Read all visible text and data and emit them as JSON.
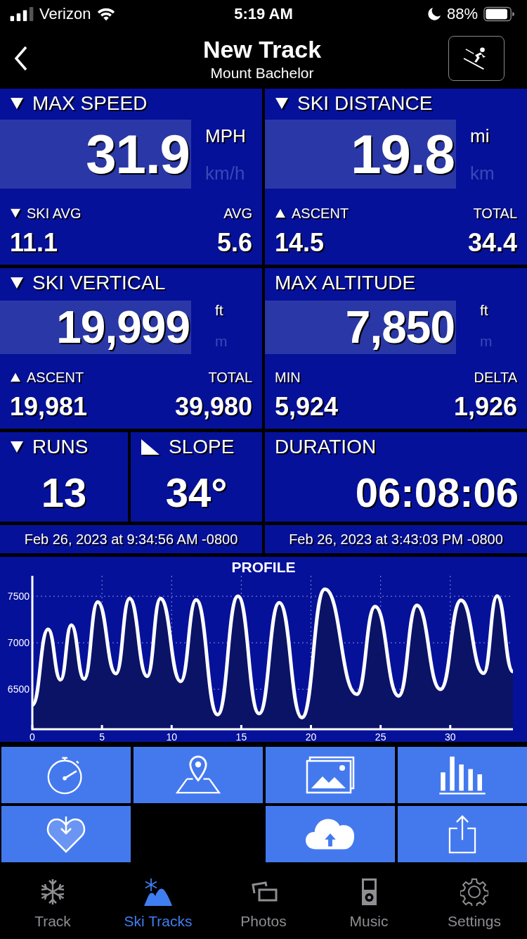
{
  "status_bar": {
    "carrier": "Verizon",
    "time": "5:19 AM",
    "battery": "88%"
  },
  "nav": {
    "title": "New Track",
    "subtitle": "Mount Bachelor"
  },
  "big_tiles": [
    {
      "icon": {
        "kind": "down"
      },
      "title": "MAX SPEED",
      "value": "31.9",
      "units": [
        {
          "label": "MPH",
          "selected": true
        },
        {
          "label": "km/h",
          "selected": false
        }
      ],
      "sub_left": {
        "icon": {
          "kind": "down"
        },
        "label": "SKI AVG",
        "value": "11.1"
      },
      "sub_right": {
        "label": "AVG",
        "value": "5.6"
      }
    },
    {
      "icon": {
        "kind": "down"
      },
      "title": "SKI DISTANCE",
      "value": "19.8",
      "units": [
        {
          "label": "mi",
          "selected": true
        },
        {
          "label": "km",
          "selected": false
        }
      ],
      "sub_left": {
        "icon": {
          "kind": "up"
        },
        "label": "ASCENT",
        "value": "14.5"
      },
      "sub_right": {
        "label": "TOTAL",
        "value": "34.4"
      }
    },
    {
      "icon": {
        "kind": "down"
      },
      "title": "SKI VERTICAL",
      "value": "19,999",
      "units": [
        {
          "label": "ft",
          "selected": true
        },
        {
          "label": "m",
          "selected": false
        }
      ],
      "sub_left": {
        "icon": {
          "kind": "up"
        },
        "label": "ASCENT",
        "value": "19,981"
      },
      "sub_right": {
        "label": "TOTAL",
        "value": "39,980"
      }
    },
    {
      "title": "MAX ALTITUDE",
      "value": "7,850",
      "units": [
        {
          "label": "ft",
          "selected": true
        },
        {
          "label": "m",
          "selected": false
        }
      ],
      "sub_left": {
        "label": "MIN",
        "value": "5,924"
      },
      "sub_right": {
        "label": "DELTA",
        "value": "1,926"
      }
    }
  ],
  "small_tiles": [
    {
      "icon": {
        "kind": "down"
      },
      "title": "RUNS",
      "value": "13"
    },
    {
      "icon": {
        "kind": "slope"
      },
      "title": "SLOPE",
      "value": "34°"
    },
    {
      "title": "DURATION",
      "value": "06:08:06"
    }
  ],
  "times": [
    "Feb 26, 2023 at 9:34:56 AM -0800",
    "Feb 26, 2023 at 3:43:03 PM -0800"
  ],
  "profile": {
    "chart_data": {
      "type": "area",
      "title": "PROFILE",
      "grid": true,
      "xlim": [
        0,
        34.5
      ],
      "ylim": [
        6070,
        7720
      ],
      "xticks": [
        0,
        5,
        10,
        15,
        20,
        25,
        30
      ],
      "yticks": [
        6500,
        7000,
        7500
      ],
      "x": [
        0,
        1.13,
        2.03,
        2.8,
        3.72,
        4.69,
        6.0,
        6.98,
        8.24,
        9.2,
        10.65,
        11.76,
        13.3,
        14.76,
        16.28,
        17.73,
        19.35,
        21.0,
        23.3,
        24.6,
        26.3,
        27.6,
        29.3,
        30.77,
        32.4,
        33.36,
        34.5
      ],
      "series": [
        {
          "color": "#ffffff",
          "values": [
            6330,
            7144,
            6601,
            7191,
            6610,
            7439,
            6668,
            7475,
            6639,
            7475,
            6585,
            7460,
            6227,
            7500,
            6238,
            7431,
            6195,
            7576,
            6446,
            7388,
            6428,
            7402,
            6500,
            7457,
            6672,
            7503,
            6690
          ]
        }
      ]
    }
  },
  "actions": [
    {
      "kind": "stopwatch"
    },
    {
      "kind": "map-pin"
    },
    {
      "kind": "photos"
    },
    {
      "kind": "bars"
    },
    {
      "kind": "heart"
    },
    {
      "kind": "cloud-upload"
    },
    {
      "kind": "share"
    }
  ],
  "tabs": [
    {
      "kind": "snowflake",
      "label": "Track",
      "selected": false
    },
    {
      "kind": "ski-tracks",
      "label": "Ski Tracks",
      "selected": true
    },
    {
      "kind": "photos",
      "label": "Photos",
      "selected": false
    },
    {
      "kind": "music",
      "label": "Music",
      "selected": false
    },
    {
      "kind": "settings",
      "label": "Settings",
      "selected": false
    }
  ]
}
